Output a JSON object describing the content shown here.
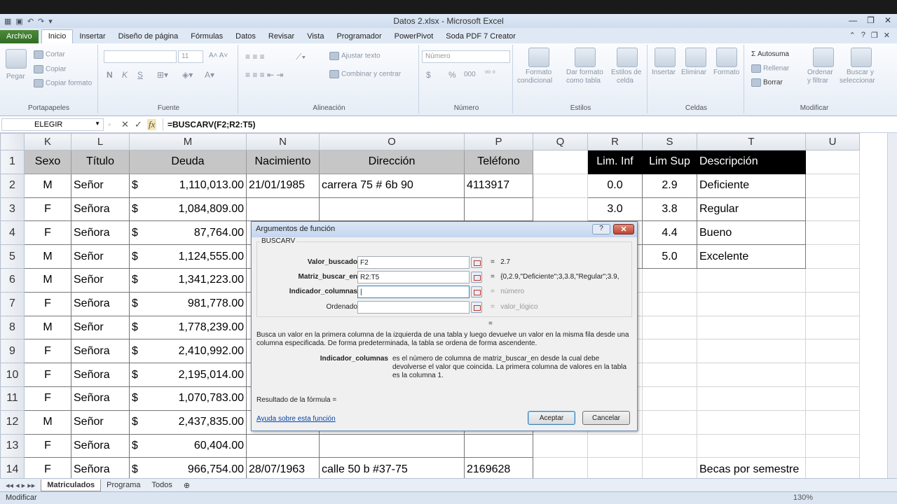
{
  "window": {
    "title": "Datos 2.xlsx - Microsoft Excel"
  },
  "tabs": [
    "Archivo",
    "Inicio",
    "Insertar",
    "Diseño de página",
    "Fórmulas",
    "Datos",
    "Revisar",
    "Vista",
    "Programador",
    "PowerPivot",
    "Soda PDF 7 Creator"
  ],
  "ribbon": {
    "clipboard": {
      "paste": "Pegar",
      "cut": "Cortar",
      "copy": "Copiar",
      "format": "Copiar formato",
      "label": "Portapapeles"
    },
    "font": {
      "size": "11",
      "bold": "N",
      "italic": "K",
      "underline": "S",
      "label": "Fuente"
    },
    "alignment": {
      "wrap": "Ajustar texto",
      "merge": "Combinar y centrar",
      "label": "Alineación"
    },
    "number": {
      "format": "Número",
      "currency": "$",
      "percent": "%",
      "comma": "000",
      "label": "Número"
    },
    "styles": {
      "cond1": "Formato",
      "cond2": "condicional",
      "table1": "Dar formato",
      "table2": "como tabla",
      "cell1": "Estilos de",
      "cell2": "celda",
      "label": "Estilos"
    },
    "cells": {
      "insert": "Insertar",
      "delete": "Eliminar",
      "format": "Formato",
      "label": "Celdas"
    },
    "editing": {
      "autosum": "Autosuma",
      "fill": "Rellenar",
      "clear": "Borrar",
      "sort1": "Ordenar",
      "sort2": "y filtrar",
      "find1": "Buscar y",
      "find2": "seleccionar",
      "label": "Modificar"
    }
  },
  "formula_bar": {
    "name_box": "ELEGIR",
    "formula": "=BUSCARV(F2;R2:T5)",
    "fx": "fx",
    "cancel": "✕",
    "enter": "✓"
  },
  "columns": [
    "K",
    "L",
    "M",
    "N",
    "O",
    "P",
    "Q",
    "R",
    "S",
    "T",
    "U"
  ],
  "rows": [
    {
      "n": "1",
      "sexo": "Sexo",
      "titulo": "Título",
      "cur": "",
      "deuda": "Deuda",
      "nac": "Nacimiento",
      "dir": "Dirección",
      "tel": "Teléfono",
      "r": "Lim. Inf",
      "s": "Lim Sup",
      "t": "Descripción"
    },
    {
      "n": "2",
      "sexo": "M",
      "titulo": "Señor",
      "cur": "$",
      "deuda": "1,110,013.00",
      "nac": "21/01/1985",
      "dir": "carrera 75 # 6b 90",
      "tel": "4113917",
      "r": "0.0",
      "s": "2.9",
      "t": "Deficiente"
    },
    {
      "n": "3",
      "sexo": "F",
      "titulo": "Señora",
      "cur": "$",
      "deuda": "1,084,809.00",
      "nac": "",
      "dir": "",
      "tel": "",
      "r": "3.0",
      "s": "3.8",
      "t": "Regular"
    },
    {
      "n": "4",
      "sexo": "F",
      "titulo": "Señora",
      "cur": "$",
      "deuda": "87,764.00",
      "nac": "",
      "dir": "",
      "tel": "",
      "r": "3.9",
      "s": "4.4",
      "t": "Bueno"
    },
    {
      "n": "5",
      "sexo": "M",
      "titulo": "Señor",
      "cur": "$",
      "deuda": "1,124,555.00",
      "nac": "",
      "dir": "",
      "tel": "",
      "r": "",
      "s": "5.0",
      "t": "Excelente"
    },
    {
      "n": "6",
      "sexo": "M",
      "titulo": "Señor",
      "cur": "$",
      "deuda": "1,341,223.00",
      "nac": "",
      "dir": "",
      "tel": "",
      "r": "",
      "s": "",
      "t": ""
    },
    {
      "n": "7",
      "sexo": "F",
      "titulo": "Señora",
      "cur": "$",
      "deuda": "981,778.00",
      "nac": "",
      "dir": "",
      "tel": "",
      "r": "",
      "s": "",
      "t": ""
    },
    {
      "n": "8",
      "sexo": "M",
      "titulo": "Señor",
      "cur": "$",
      "deuda": "1,778,239.00",
      "nac": "",
      "dir": "",
      "tel": "",
      "r": "",
      "s": "",
      "t": ""
    },
    {
      "n": "9",
      "sexo": "F",
      "titulo": "Señora",
      "cur": "$",
      "deuda": "2,410,992.00",
      "nac": "",
      "dir": "",
      "tel": "",
      "r": "",
      "s": "",
      "t": ""
    },
    {
      "n": "10",
      "sexo": "F",
      "titulo": "Señora",
      "cur": "$",
      "deuda": "2,195,014.00",
      "nac": "",
      "dir": "",
      "tel": "",
      "r": "",
      "s": "",
      "t": ""
    },
    {
      "n": "11",
      "sexo": "F",
      "titulo": "Señora",
      "cur": "$",
      "deuda": "1,070,783.00",
      "nac": "",
      "dir": "",
      "tel": "",
      "r": "",
      "s": "",
      "t": ""
    },
    {
      "n": "12",
      "sexo": "M",
      "titulo": "Señor",
      "cur": "$",
      "deuda": "2,437,835.00",
      "nac": "",
      "dir": "",
      "tel": "",
      "r": "",
      "s": "",
      "t": ""
    },
    {
      "n": "13",
      "sexo": "F",
      "titulo": "Señora",
      "cur": "$",
      "deuda": "60,404.00",
      "nac": "",
      "dir": "",
      "tel": "",
      "r": "",
      "s": "",
      "t": ""
    },
    {
      "n": "14",
      "sexo": "F",
      "titulo": "Señora",
      "cur": "$",
      "deuda": "966,754.00",
      "nac": "28/07/1963",
      "dir": "calle 50 b #37-75",
      "tel": "2169628",
      "r": "",
      "s": "",
      "t": "Becas por semestre"
    }
  ],
  "dialog": {
    "title": "Argumentos de función",
    "q": "?",
    "close": "✕",
    "func": "BUSCARV",
    "args": [
      {
        "label": "Valor_buscado",
        "value": "F2",
        "result": "2.7"
      },
      {
        "label": "Matriz_buscar_en",
        "value": "R2:T5",
        "result": "{0,2.9,\"Deficiente\";3,3.8,\"Regular\";3.9,"
      },
      {
        "label": "Indicador_columnas",
        "value": "|",
        "result": "número"
      },
      {
        "label": "Ordenado",
        "value": "",
        "result": "valor_lógico"
      }
    ],
    "eq": "=",
    "eq2": "=",
    "desc": "Busca un valor en la primera columna de la izquierda de una tabla y luego devuelve un valor en la misma fila desde una columna especificada. De forma predeterminada, la tabla se ordena de forma ascendente.",
    "arg_name": "Indicador_columnas",
    "arg_desc": "es el número de columna de matriz_buscar_en desde la cual debe devolverse el valor que coincida. La primera columna de valores en la tabla es la columna 1.",
    "result_label": "Resultado de la fórmula =",
    "help": "Ayuda sobre esta función",
    "ok": "Aceptar",
    "cancel": "Cancelar"
  },
  "sheet_tabs": [
    "Matriculados",
    "Programa",
    "Todos"
  ],
  "status": {
    "mode": "Modificar",
    "zoom": "130%"
  }
}
